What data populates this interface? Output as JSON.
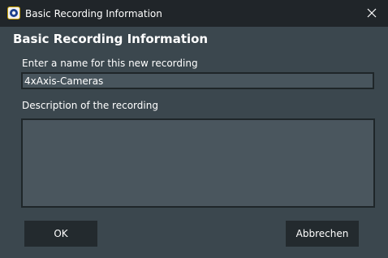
{
  "window": {
    "title": "Basic Recording Information",
    "app_icon": "vsp-app-icon",
    "close_icon": "close-icon"
  },
  "form": {
    "heading": "Basic Recording Information",
    "name_label": "Enter a name for this new recording",
    "name_value": "4xAxis-Cameras",
    "description_label": "Description of the recording",
    "description_value": ""
  },
  "buttons": {
    "ok_label": "OK",
    "cancel_label": "Abbrechen"
  },
  "colors": {
    "titlebar": "#202529",
    "background": "#3b474e",
    "input_background": "#48555d",
    "button_background": "#232a2e",
    "text": "#ffffff"
  }
}
